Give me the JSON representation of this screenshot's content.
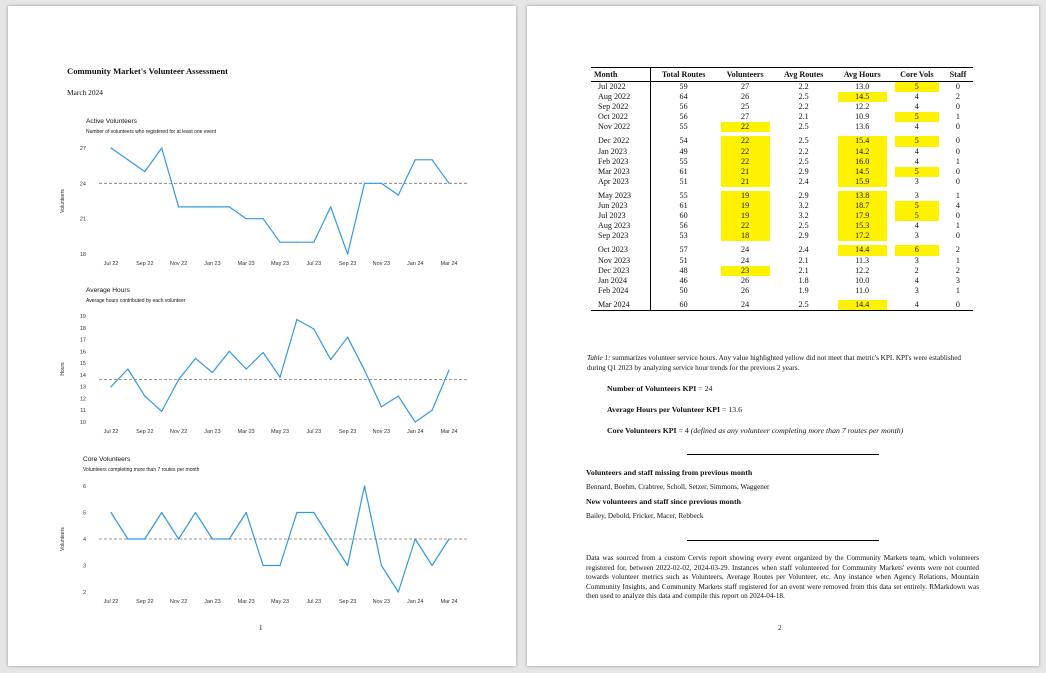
{
  "page1": {
    "title": "Community Market's Volunteer Assessment",
    "date": "March 2024",
    "page_number": "1",
    "charts_meta": {
      "x_ticks": [
        "Jul 22",
        "Sep 22",
        "Nov 22",
        "Jan 23",
        "Mar 23",
        "May 23",
        "Jul 23",
        "Sep 23",
        "Nov 23",
        "Jan 24",
        "Mar 24"
      ]
    }
  },
  "chart_data": [
    {
      "type": "line",
      "title": "Active Volunteers",
      "subtitle": "Number of volunteers who registered for at least one event",
      "ylabel": "Volunteers",
      "xlabel": "",
      "x": [
        "Jul 22",
        "Aug 22",
        "Sep 22",
        "Oct 22",
        "Nov 22",
        "Dec 22",
        "Jan 23",
        "Feb 23",
        "Mar 23",
        "Apr 23",
        "May 23",
        "Jun 23",
        "Jul 23",
        "Aug 23",
        "Sep 23",
        "Oct 23",
        "Nov 23",
        "Dec 23",
        "Jan 24",
        "Feb 24",
        "Mar 24"
      ],
      "values": [
        27,
        26,
        25,
        27,
        22,
        22,
        22,
        22,
        21,
        21,
        19,
        19,
        19,
        22,
        18,
        24,
        24,
        23,
        26,
        26,
        24
      ],
      "reference_line": 24,
      "ylim": [
        18,
        27
      ],
      "y_ticks": [
        18,
        21,
        24,
        27
      ],
      "color": "#3399dd"
    },
    {
      "type": "line",
      "title": "Average Hours",
      "subtitle": "Average hours contributed by each volunteer",
      "ylabel": "Hours",
      "xlabel": "",
      "x": [
        "Jul 22",
        "Aug 22",
        "Sep 22",
        "Oct 22",
        "Nov 22",
        "Dec 22",
        "Jan 23",
        "Feb 23",
        "Mar 23",
        "Apr 23",
        "May 23",
        "Jun 23",
        "Jul 23",
        "Aug 23",
        "Sep 23",
        "Oct 23",
        "Nov 23",
        "Dec 23",
        "Jan 24",
        "Feb 24",
        "Mar 24"
      ],
      "values": [
        13.0,
        14.5,
        12.2,
        10.9,
        13.6,
        15.4,
        14.2,
        16.0,
        14.5,
        15.9,
        13.8,
        18.7,
        17.9,
        15.3,
        17.2,
        14.4,
        11.3,
        12.2,
        10.0,
        11.0,
        14.4
      ],
      "reference_line": 13.6,
      "ylim": [
        10,
        19
      ],
      "y_ticks": [
        10,
        11,
        12,
        13,
        14,
        15,
        16,
        17,
        18,
        19
      ],
      "color": "#3399dd"
    },
    {
      "type": "line",
      "title": "Core Volunteers",
      "subtitle": "Volunteers completing more than 7 routes per month",
      "ylabel": "Volunteers",
      "xlabel": "",
      "x": [
        "Jul 22",
        "Aug 22",
        "Sep 22",
        "Oct 22",
        "Nov 22",
        "Dec 22",
        "Jan 23",
        "Feb 23",
        "Mar 23",
        "Apr 23",
        "May 23",
        "Jun 23",
        "Jul 23",
        "Aug 23",
        "Sep 23",
        "Oct 23",
        "Nov 23",
        "Dec 23",
        "Jan 24",
        "Feb 24",
        "Mar 24"
      ],
      "values": [
        5,
        4,
        4,
        5,
        4,
        5,
        4,
        4,
        5,
        3,
        3,
        5,
        5,
        4,
        3,
        6,
        3,
        2,
        4,
        3,
        4
      ],
      "reference_line": 4,
      "ylim": [
        2,
        6
      ],
      "y_ticks": [
        2,
        3,
        4,
        5,
        6
      ],
      "color": "#3399dd"
    }
  ],
  "page2": {
    "page_number": "2",
    "table": {
      "headers": [
        "Month",
        "Total Routes",
        "Volunteers",
        "Avg Routes",
        "Avg Hours",
        "Core Vols",
        "Staff"
      ],
      "groups": [
        [
          {
            "cells": [
              "Jul 2022",
              "59",
              "27",
              "2.2",
              "13.0",
              "5",
              "0"
            ],
            "hl": [
              5
            ]
          },
          {
            "cells": [
              "Aug 2022",
              "64",
              "26",
              "2.5",
              "14.5",
              "4",
              "2"
            ],
            "hl": [
              4
            ]
          },
          {
            "cells": [
              "Sep 2022",
              "56",
              "25",
              "2.2",
              "12.2",
              "4",
              "0"
            ],
            "hl": []
          },
          {
            "cells": [
              "Oct 2022",
              "56",
              "27",
              "2.1",
              "10.9",
              "5",
              "1"
            ],
            "hl": [
              5
            ]
          },
          {
            "cells": [
              "Nov 2022",
              "55",
              "22",
              "2.5",
              "13.6",
              "4",
              "0"
            ],
            "hl": [
              2
            ]
          }
        ],
        [
          {
            "cells": [
              "Dec 2022",
              "54",
              "22",
              "2.5",
              "15.4",
              "5",
              "0"
            ],
            "hl": [
              2,
              4,
              5
            ]
          },
          {
            "cells": [
              "Jan 2023",
              "49",
              "22",
              "2.2",
              "14.2",
              "4",
              "0"
            ],
            "hl": [
              2,
              4
            ]
          },
          {
            "cells": [
              "Feb 2023",
              "55",
              "22",
              "2.5",
              "16.0",
              "4",
              "1"
            ],
            "hl": [
              2,
              4
            ]
          },
          {
            "cells": [
              "Mar 2023",
              "61",
              "21",
              "2.9",
              "14.5",
              "5",
              "0"
            ],
            "hl": [
              2,
              4,
              5
            ]
          },
          {
            "cells": [
              "Apr 2023",
              "51",
              "21",
              "2.4",
              "15.9",
              "3",
              "0"
            ],
            "hl": [
              2,
              4
            ]
          }
        ],
        [
          {
            "cells": [
              "May 2023",
              "55",
              "19",
              "2.9",
              "13.8",
              "3",
              "1"
            ],
            "hl": [
              2,
              4
            ]
          },
          {
            "cells": [
              "Jun 2023",
              "61",
              "19",
              "3.2",
              "18.7",
              "5",
              "4"
            ],
            "hl": [
              2,
              4,
              5
            ]
          },
          {
            "cells": [
              "Jul 2023",
              "60",
              "19",
              "3.2",
              "17.9",
              "5",
              "0"
            ],
            "hl": [
              2,
              4,
              5
            ]
          },
          {
            "cells": [
              "Aug 2023",
              "56",
              "22",
              "2.5",
              "15.3",
              "4",
              "1"
            ],
            "hl": [
              2,
              4
            ]
          },
          {
            "cells": [
              "Sep 2023",
              "53",
              "18",
              "2.9",
              "17.2",
              "3",
              "0"
            ],
            "hl": [
              2,
              4
            ]
          }
        ],
        [
          {
            "cells": [
              "Oct 2023",
              "57",
              "24",
              "2.4",
              "14.4",
              "6",
              "2"
            ],
            "hl": [
              4,
              5
            ]
          },
          {
            "cells": [
              "Nov 2023",
              "51",
              "24",
              "2.1",
              "11.3",
              "3",
              "1"
            ],
            "hl": []
          },
          {
            "cells": [
              "Dec 2023",
              "48",
              "23",
              "2.1",
              "12.2",
              "2",
              "2"
            ],
            "hl": [
              2
            ]
          },
          {
            "cells": [
              "Jan 2024",
              "46",
              "26",
              "1.8",
              "10.0",
              "4",
              "3"
            ],
            "hl": []
          },
          {
            "cells": [
              "Feb 2024",
              "50",
              "26",
              "1.9",
              "11.0",
              "3",
              "1"
            ],
            "hl": []
          }
        ],
        [
          {
            "cells": [
              "Mar 2024",
              "60",
              "24",
              "2.5",
              "14.4",
              "4",
              "0"
            ],
            "hl": [
              4
            ]
          }
        ]
      ],
      "highlight_color": "#fff200"
    },
    "caption_label": "Table 1:",
    "caption_text": " summarizes volunteer service hours. Any value highlighted yellow did not meet that metric's KPI. KPI's were established during Q1 2023 by analyzing service hour trends for the previous 2 years.",
    "kpi1_label": "Number of Volunteers KPI",
    "kpi1_value": " = 24",
    "kpi2_label": "Average Hours per Volunteer KPI",
    "kpi2_value": " = 13.6",
    "kpi3_label": "Core Volunteers KPI",
    "kpi3_value": " = 4 ",
    "kpi3_note": "(defined as any volunteer completing more than 7 routes per month)",
    "missing_heading": "Volunteers and staff missing from previous month",
    "missing_names": "Bennard, Boehm, Crabtree, Scholl, Setzer, Simmons, Waggener",
    "new_heading": "New volunteers and staff since previous month",
    "new_names": "Bailey, Debold, Fricker, Macer, Rebbeck",
    "footer": "Data was sourced from a custom Cervis report showing every event organized by the Community Markets team, which volunteers registered for, between 2022-02-02, 2024-03-29. Instances when staff volunteered for Community Markets' events were not counted towards volunteer metrics such as Volunteers, Average Routes per Volunteer, etc. Any instance when Agency Relations, Mountain Community Insights, and Community Markets staff registered for an event were removed from this data set entirely. RMarkdown was then used to analyze this data and compile this report on 2024-04-18."
  }
}
